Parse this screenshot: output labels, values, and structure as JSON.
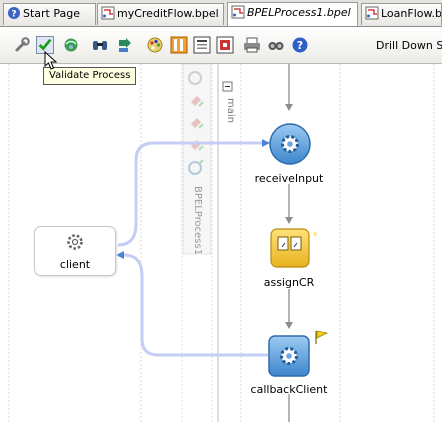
{
  "tabs": [
    {
      "label": "Start Page",
      "icon": "help-icon",
      "active": false
    },
    {
      "label": "myCreditFlow.bpel",
      "icon": "bpel-file-icon",
      "active": false
    },
    {
      "label": "BPELProcess1.bpel",
      "icon": "bpel-file-icon",
      "active": true
    },
    {
      "label": "LoanFlow.bpe",
      "icon": "bpel-file-icon",
      "active": false
    }
  ],
  "toolbar": {
    "drill_label": "Drill Down Sta",
    "tooltip": "Validate Process"
  },
  "diagram": {
    "client_label": "client",
    "process_label": "BPELProcess1",
    "scope_label": "main",
    "activities": [
      {
        "label": "receiveInput",
        "icon": "gear-icon"
      },
      {
        "label": "assignCR",
        "icon": "assign-icon"
      },
      {
        "label": "callbackClient",
        "icon": "gear-icon"
      }
    ]
  },
  "colors": {
    "connector": "#c4cdf4",
    "activity_fill": "#5ea0dc",
    "assign_fill": "#f0c230",
    "flow_arrow": "#8c8c8c",
    "validate_check": "#1a9a1a"
  }
}
